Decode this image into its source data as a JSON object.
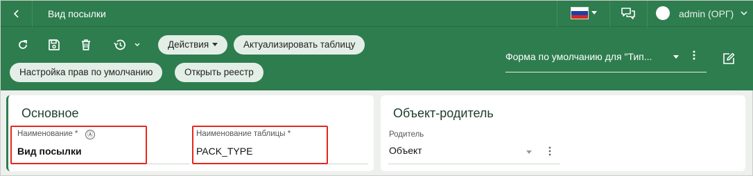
{
  "header": {
    "title": "Вид посылки",
    "user": "admin (ОРГ)",
    "flag_colors": [
      "#ffffff",
      "#1c3fa8",
      "#d52b1e"
    ]
  },
  "toolbar": {
    "actions_label": "Действия",
    "update_table_label": "Актуализировать таблицу",
    "default_rights_label": "Настройка прав по умолчанию",
    "open_registry_label": "Открыть реестр",
    "form_select_value": "Форма по умолчанию для \"Тип..."
  },
  "main_section": {
    "title": "Основное",
    "name_label": "Наименование *",
    "name_value": "Вид посылки",
    "table_name_label": "Наименование таблицы *",
    "table_name_value": "PACK_TYPE",
    "auto_icon": "Ⓐ"
  },
  "parent_section": {
    "title": "Объект-родитель",
    "parent_label": "Родитель",
    "parent_value": "Объект"
  },
  "colors": {
    "brand_green": "#2e7d4f",
    "highlight_red": "#e3261c"
  }
}
